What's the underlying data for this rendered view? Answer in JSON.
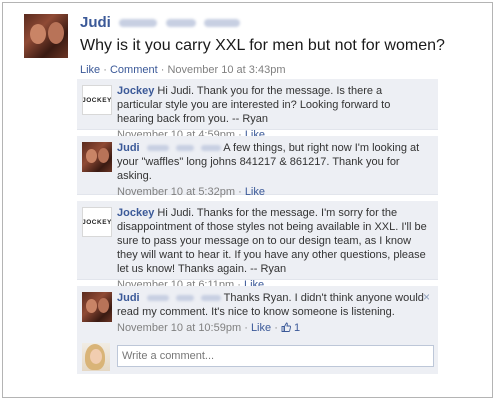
{
  "post": {
    "author": "Judi",
    "text": "Why is it you carry XXL for men but not for women?",
    "like_label": "Like",
    "comment_label": "Comment",
    "timestamp": "November 10 at 3:43pm",
    "separator": "·"
  },
  "comments": [
    {
      "author": "Jockey",
      "text": "Hi Judi. Thank you for the message. Is there a particular style you are interested in? Looking forward to hearing back from you. -- Ryan",
      "timestamp": "November 10 at 4:59pm",
      "like_label": "Like"
    },
    {
      "author": "Judi",
      "text": "A few things, but right now I'm looking at your \"waffles\" long johns 841217 & 861217. Thank you for asking.",
      "timestamp": "November 10 at 5:32pm",
      "like_label": "Like"
    },
    {
      "author": "Jockey",
      "text": "Hi Judi. Thanks for the message. I'm sorry for the disappointment of those styles not being available in XXL. I'll be sure to pass your message on to our design team, as I know they will want to hear it. If you have any other questions, please let us know! Thanks again. -- Ryan",
      "timestamp": "November 10 at 6:11pm",
      "like_label": "Like"
    },
    {
      "author": "Judi",
      "text": "Thanks Ryan. I didn't think anyone would read my comment. It's nice to know someone is listening.",
      "timestamp": "November 10 at 10:59pm",
      "like_label": "Like",
      "like_count": "1"
    }
  ],
  "jockey_logo_text": "JOCKEY",
  "close_glyph": "×",
  "write_comment": {
    "placeholder": "Write a comment..."
  },
  "colors": {
    "link": "#3b5998",
    "comment_bg": "#edeff4",
    "meta": "#808080"
  }
}
